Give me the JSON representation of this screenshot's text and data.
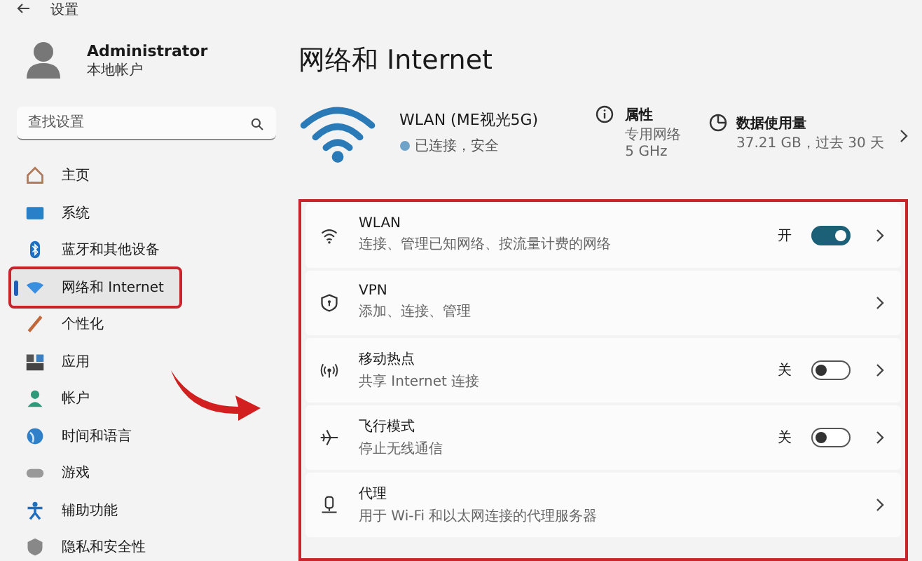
{
  "window": {
    "title": "设置"
  },
  "profile": {
    "name": "Administrator",
    "account_type": "本地帐户"
  },
  "search": {
    "placeholder": "查找设置"
  },
  "sidebar": {
    "items": [
      {
        "label": "主页",
        "selected": false
      },
      {
        "label": "系统",
        "selected": false
      },
      {
        "label": "蓝牙和其他设备",
        "selected": false
      },
      {
        "label": "网络和 Internet",
        "selected": true
      },
      {
        "label": "个性化",
        "selected": false
      },
      {
        "label": "应用",
        "selected": false
      },
      {
        "label": "帐户",
        "selected": false
      },
      {
        "label": "时间和语言",
        "selected": false
      },
      {
        "label": "游戏",
        "selected": false
      },
      {
        "label": "辅助功能",
        "selected": false
      },
      {
        "label": "隐私和安全性",
        "selected": false
      }
    ]
  },
  "page_title": "网络和 Internet",
  "connection": {
    "name": "WLAN (ME视光5G)",
    "status": "已连接，安全"
  },
  "properties": {
    "title": "属性",
    "lines": [
      "专用网络",
      "5 GHz"
    ]
  },
  "data_usage": {
    "title": "数据使用量",
    "detail": "37.21 GB，过去 30 天"
  },
  "cards": [
    {
      "kind": "toggle",
      "title": "WLAN",
      "subtitle": "连接、管理已知网络、按流量计费的网络",
      "state_label": "开",
      "on": true
    },
    {
      "kind": "link",
      "title": "VPN",
      "subtitle": "添加、连接、管理"
    },
    {
      "kind": "toggle",
      "title": "移动热点",
      "subtitle": "共享 Internet 连接",
      "state_label": "关",
      "on": false
    },
    {
      "kind": "toggle",
      "title": "飞行模式",
      "subtitle": "停止无线通信",
      "state_label": "关",
      "on": false
    },
    {
      "kind": "link",
      "title": "代理",
      "subtitle": "用于 Wi-Fi 和以太网连接的代理服务器"
    }
  ]
}
